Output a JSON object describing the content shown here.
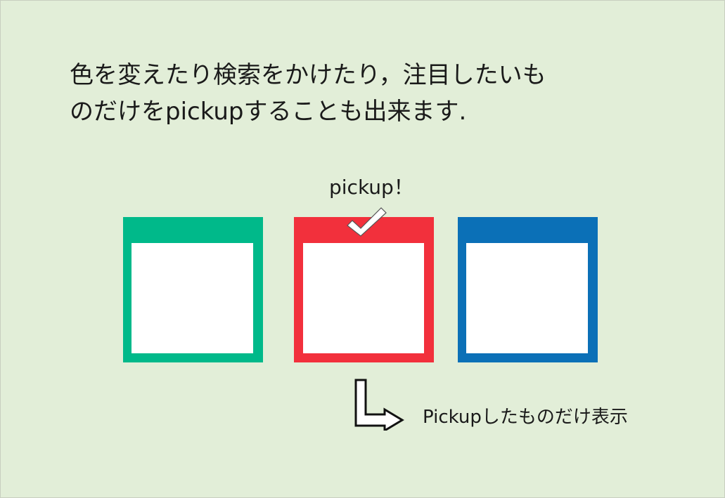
{
  "heading": {
    "line1": "色を変えたり検索をかけたり，注目したいも",
    "line2": "のだけをpickupすることも出来ます."
  },
  "pickup_label": "pickup！",
  "caption": "Pickupしたものだけ表示",
  "cards": [
    {
      "name": "green",
      "color": "#00b98a",
      "selected": false
    },
    {
      "name": "red",
      "color": "#f2303c",
      "selected": true
    },
    {
      "name": "blue",
      "color": "#0b70b7",
      "selected": false
    }
  ],
  "colors": {
    "background": "#e2eed8",
    "green": "#00b98a",
    "red": "#f2303c",
    "blue": "#0b70b7"
  }
}
